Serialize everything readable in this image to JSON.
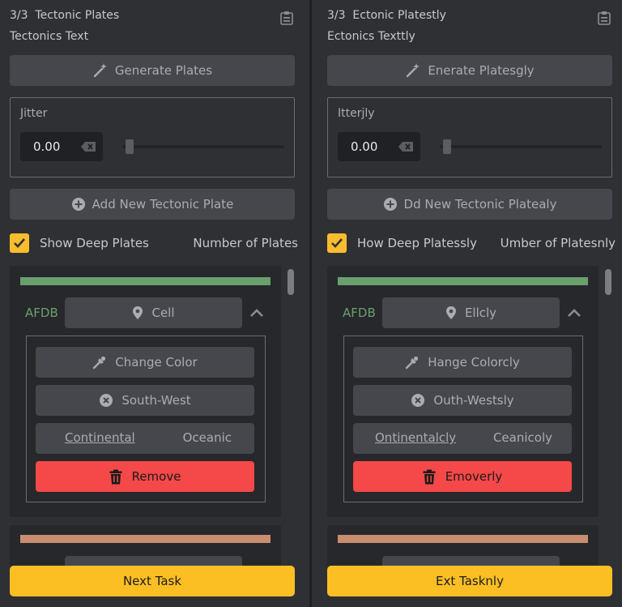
{
  "colors": {
    "background": "#2f3034",
    "accent_yellow": "#fbbf24",
    "danger_red": "#f54848",
    "plate1_color": "#6aa06e",
    "plate2_color": "#c98d70",
    "plate_id_color": "#6aa06e"
  },
  "left": {
    "header": "3/3  Tectonic Plates",
    "subtitle": "Tectonics Text",
    "generate_label": "Generate Plates",
    "jitter_label": "Jitter",
    "jitter_value": "0.00",
    "add_plate_label": "Add New Tectonic Plate",
    "show_deep_label": "Show Deep Plates",
    "number_of_plates_label": "Number of Plates",
    "plate": {
      "id": "AFDB",
      "cell_label": "Cell",
      "change_color_label": "Change Color",
      "direction_label": "South-West",
      "type_option_a": "Continental",
      "type_option_b": "Oceanic",
      "remove_label": "Remove"
    },
    "next_label": "Next Task"
  },
  "right": {
    "header": "3/3  Ectonic Platestly",
    "subtitle": "Ectonics Texttly",
    "generate_label": "Enerate Platesgly",
    "jitter_label": "Itterjly",
    "jitter_value": "0.00",
    "add_plate_label": "Dd New Tectonic Platealy",
    "show_deep_label": "How Deep Platessly",
    "number_of_plates_label": "Umber of Platesnly",
    "plate": {
      "id": "AFDB",
      "cell_label": "Ellcly",
      "change_color_label": "Hange Colorcly",
      "direction_label": "Outh-Westsly",
      "type_option_a": "Ontinentalcly",
      "type_option_b": "Ceanicoly",
      "remove_label": "Emoverly"
    },
    "next_label": "Ext Tasknly"
  },
  "icons": {
    "clipboard": "clipboard-icon",
    "generate": "magic-wand-icon",
    "clear": "backspace-icon",
    "add": "plus-circle-icon",
    "check": "checkmark-icon",
    "location": "map-pin-icon",
    "collapse": "chevron-up-icon",
    "color": "eyedropper-icon",
    "direction": "x-circle-icon",
    "remove": "trash-icon"
  }
}
